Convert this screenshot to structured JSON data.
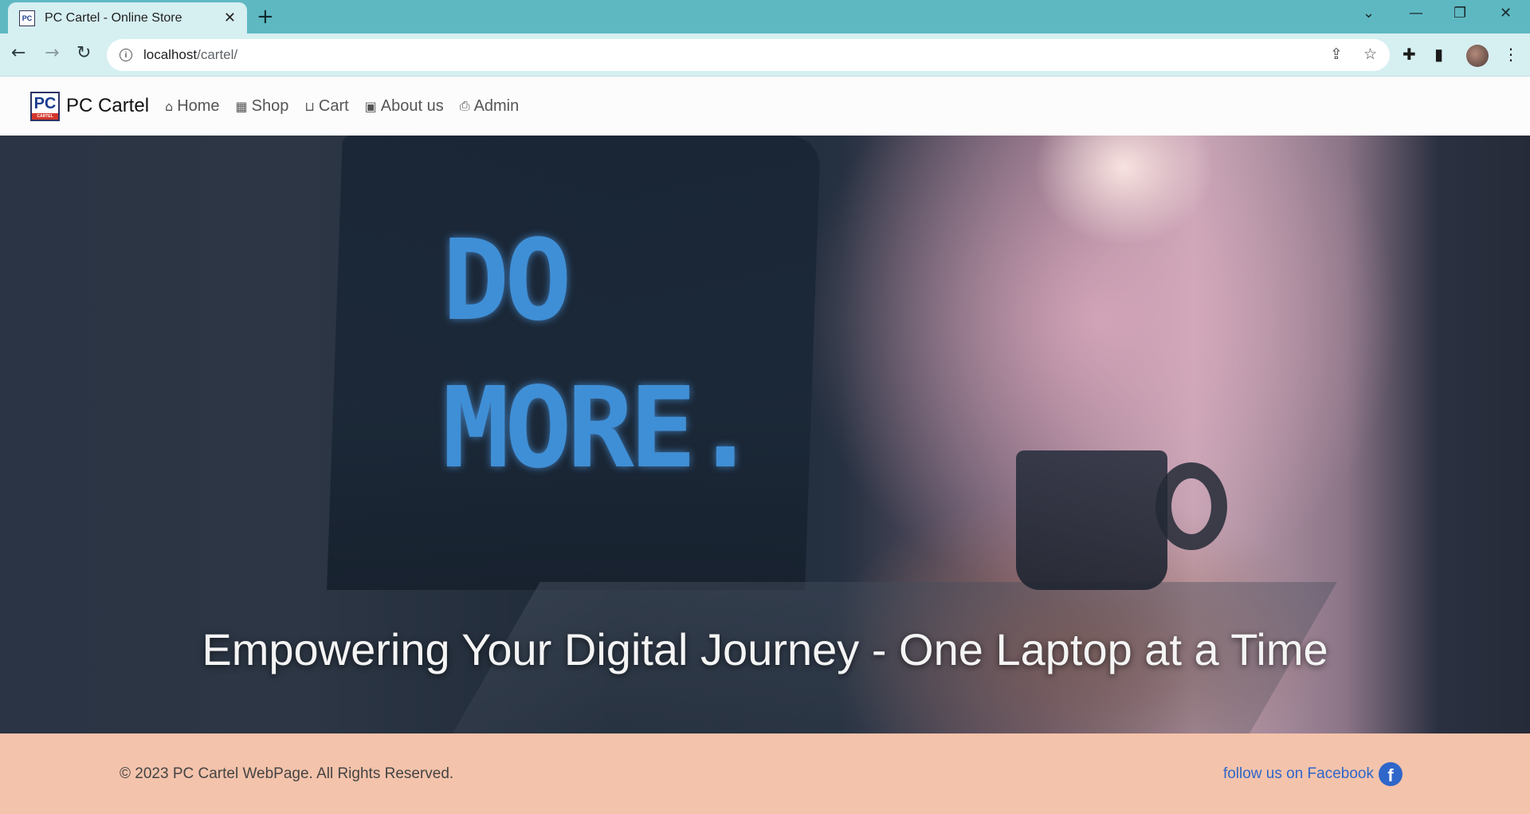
{
  "browser": {
    "tab_title": "PC Cartel - Online Store",
    "favicon_text": "PC",
    "url_host": "localhost",
    "url_path": "/cartel/"
  },
  "navbar": {
    "brand_name": "PC Cartel",
    "logo_text": "PC",
    "logo_subtext": "CARTEL",
    "links": [
      {
        "label": "Home",
        "icon": "home-icon"
      },
      {
        "label": "Shop",
        "icon": "shop-icon"
      },
      {
        "label": "Cart",
        "icon": "cart-icon"
      },
      {
        "label": "About us",
        "icon": "about-icon"
      },
      {
        "label": "Admin",
        "icon": "admin-icon"
      }
    ]
  },
  "hero": {
    "image_text_line1": "DO",
    "image_text_line2": "MORE.",
    "tagline": "Empowering Your Digital Journey - One Laptop at a Time"
  },
  "footer": {
    "copyright": "© 2023 PC Cartel WebPage. All Rights Reserved.",
    "facebook_label": "follow us on Facebook"
  },
  "colors": {
    "tabbar": "#5eb8c2",
    "toolbar": "#d6eff1",
    "footer_bg": "#f4c3ab",
    "link": "#2f66c9"
  }
}
